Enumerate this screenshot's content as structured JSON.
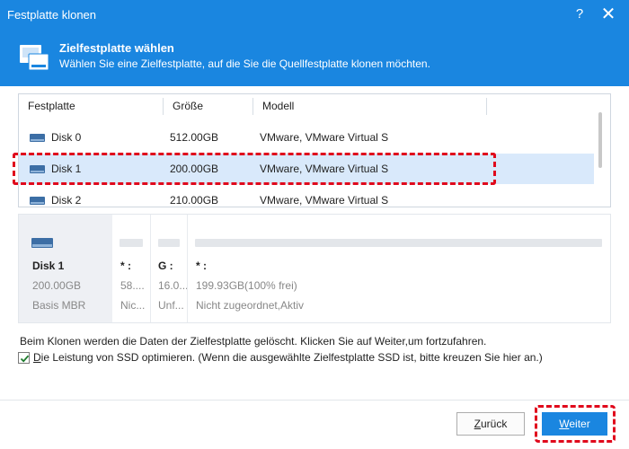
{
  "window": {
    "title": "Festplatte klonen",
    "help_glyph": "?",
    "close_glyph": "✕"
  },
  "header": {
    "heading": "Zielfestplatte wählen",
    "subtitle": "Wählen Sie eine Zielfestplatte, auf die Sie die Quellfestplatte klonen möchten."
  },
  "disk_table": {
    "columns": [
      "Festplatte",
      "Größe",
      "Modell"
    ],
    "rows": [
      {
        "name": "Disk 0",
        "size": "512.00GB",
        "model": "VMware, VMware Virtual S",
        "selected": false
      },
      {
        "name": "Disk 1",
        "size": "200.00GB",
        "model": "VMware, VMware Virtual S",
        "selected": true
      },
      {
        "name": "Disk 2",
        "size": "210.00GB",
        "model": "VMware, VMware Virtual S",
        "selected": false
      }
    ]
  },
  "partition_panel": {
    "disk_name": "Disk 1",
    "disk_size": "200.00GB",
    "disk_type": "Basis MBR",
    "partitions": [
      {
        "label": "* :",
        "capacity": "58....",
        "status": "Nic..."
      },
      {
        "label": "G :",
        "capacity": "16.0...",
        "status": "Unf..."
      },
      {
        "label": "* :",
        "capacity": "199.93GB(100% frei)",
        "status": "Nicht zugeordnet,Aktiv"
      }
    ]
  },
  "warning_text": "Beim Klonen werden die Daten der Zielfestplatte gelöscht. Klicken Sie auf Weiter,um fortzufahren.",
  "ssd_option": {
    "checked": true,
    "label_underlined_char": "D",
    "label_rest": "ie Leistung von SSD optimieren. (Wenn die ausgewählte Zielfestplatte SSD ist, bitte kreuzen Sie hier an.)"
  },
  "buttons": {
    "back_underlined_char": "Z",
    "back_rest": "urück",
    "next_underlined_char": "W",
    "next_rest": "eiter"
  },
  "colors": {
    "accent": "#1a86e0",
    "selected_row": "#d9e9fb",
    "highlight_outline": "#e0091c",
    "disk_icon": "#3c6ea5"
  }
}
